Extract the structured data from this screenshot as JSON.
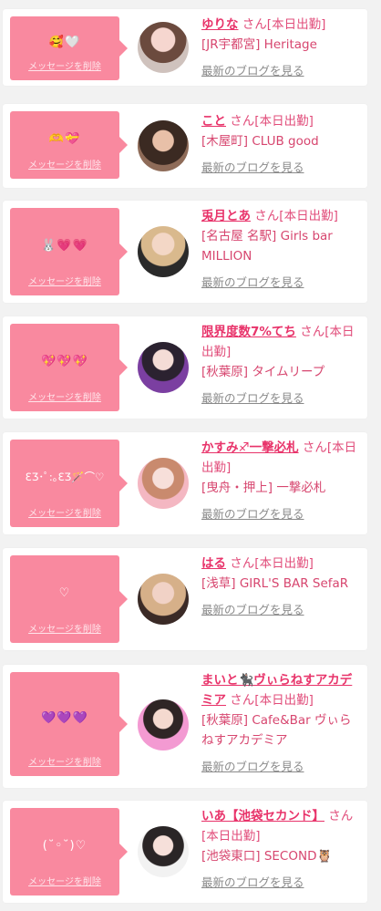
{
  "common": {
    "delete_label": "メッセージを削除",
    "blog_label": "最新のブログを見る"
  },
  "colors": {
    "accent_pink": "#f9899f",
    "name_pink": "#e8336a",
    "link_gray": "#8a8a8a"
  },
  "messages": [
    {
      "text": "🥰🤍",
      "name": "ゆりな",
      "honor": "さん[本日出勤]",
      "shop": "[JR宇都宮] Heritage",
      "avatar_icon": "avatar-photo"
    },
    {
      "text": "🫶💝",
      "name": "こと",
      "honor": "さん[本日出勤]",
      "shop": "[木屋町] CLUB good",
      "avatar_icon": "avatar-photo"
    },
    {
      "text": "🐰💗💗",
      "name": "兎月とあ",
      "honor": "さん[本日出勤]",
      "shop": "[名古屋 名駅] Girls bar MILLION",
      "avatar_icon": "avatar-photo"
    },
    {
      "text": "💖💖💖",
      "name": "限界度数7%てち",
      "honor": "さん[本日出勤]",
      "shop": "[秋葉原] タイムリープ",
      "avatar_icon": "avatar-photo"
    },
    {
      "text": "ƐƷ･ﾟ:｡ƐƷ🪄⌒♡",
      "name": "かすみ♐一撃必札",
      "honor": "さん[本日出勤]",
      "shop": "[曳舟・押上] 一撃必札",
      "avatar_icon": "avatar-photo"
    },
    {
      "text": "♡",
      "name": "はる",
      "honor": "さん[本日出勤]",
      "shop": "[浅草] GIRL'S BAR SefaR",
      "avatar_icon": "avatar-photo"
    },
    {
      "text": "💜💜💜",
      "name": "まいと🐈‍⬛ヴぃらねすアカデミア",
      "honor": "さん[本日出勤]",
      "shop": "[秋葉原] Cafe&Bar ヴぃらねすアカデミア",
      "avatar_icon": "avatar-photo"
    },
    {
      "text": "(˘◦˘)♡",
      "name": "いあ【池袋セカンド】",
      "honor": "さん[本日出勤]",
      "shop": "[池袋東口] SECOND🦉",
      "avatar_icon": "avatar-photo"
    }
  ]
}
